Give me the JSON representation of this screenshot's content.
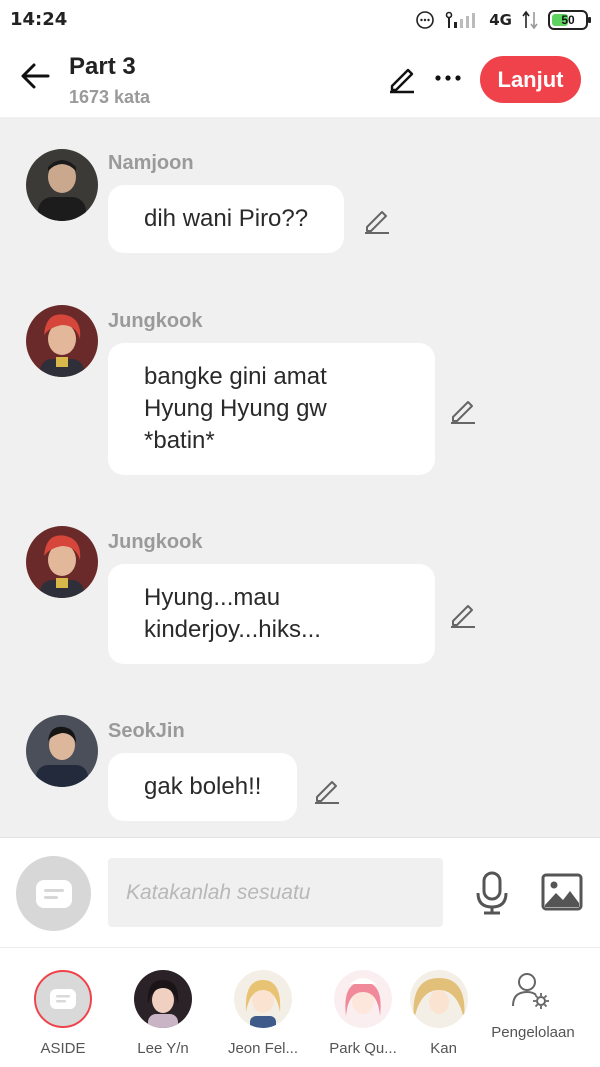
{
  "status_bar": {
    "time": "14:24",
    "network": "4G",
    "battery": "50",
    "battery_level": 0.5
  },
  "header": {
    "title": "Part 3",
    "word_count": "1673 kata",
    "next_label": "Lanjut"
  },
  "messages": [
    {
      "sender": "Namjoon",
      "lines": [
        "dih wani Piro??"
      ]
    },
    {
      "sender": "Jungkook",
      "lines": [
        "bangke gini amat",
        "Hyung Hyung gw",
        "*batin*"
      ]
    },
    {
      "sender": "Jungkook",
      "lines": [
        "Hyung...mau",
        "kinderjoy...hiks..."
      ]
    },
    {
      "sender": "SeokJin",
      "lines": [
        "gak boleh!!"
      ]
    }
  ],
  "composer": {
    "placeholder": "Katakanlah sesuatu"
  },
  "characters": [
    {
      "label": "ASIDE"
    },
    {
      "label": "Lee Y/n"
    },
    {
      "label": "Jeon Fel..."
    },
    {
      "label": "Park Qu..."
    },
    {
      "label": "Kan"
    }
  ],
  "manage_label": "Pengelolaan",
  "colors": {
    "accent": "#f0424a",
    "background": "#f0f0f0",
    "bubble": "#ffffff",
    "muted_text": "#9a9a9a"
  },
  "icons": [
    "back-arrow-icon",
    "pencil-icon",
    "more-icon",
    "microphone-icon",
    "image-icon",
    "chat-bubble-icon",
    "user-settings-icon",
    "signal-icon",
    "wifi-icon",
    "sync-icon"
  ]
}
